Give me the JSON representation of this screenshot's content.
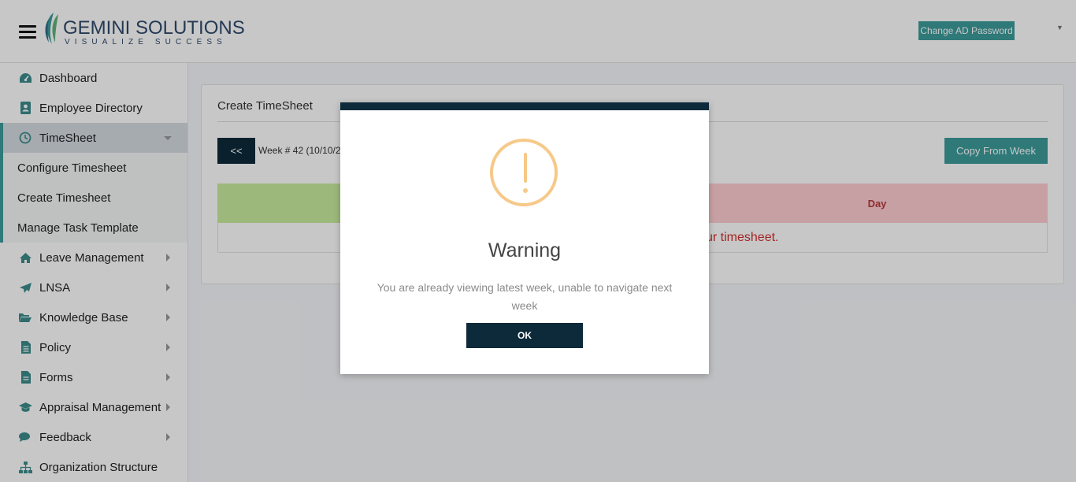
{
  "header": {
    "logo_title": "GEMINI SOLUTIONS",
    "logo_tagline": "VISUALIZE SUCCESS",
    "change_password_label": "Change AD Password"
  },
  "sidebar": {
    "items": [
      {
        "label": "Dashboard",
        "icon": "dashboard-icon"
      },
      {
        "label": "Employee Directory",
        "icon": "contact-book-icon"
      },
      {
        "label": "TimeSheet",
        "icon": "clock-icon"
      },
      {
        "label": "Leave Management",
        "icon": "home-icon"
      },
      {
        "label": "LNSA",
        "icon": "paper-plane-icon"
      },
      {
        "label": "Knowledge Base",
        "icon": "folder-open-icon"
      },
      {
        "label": "Policy",
        "icon": "document-icon"
      },
      {
        "label": "Forms",
        "icon": "file-icon"
      },
      {
        "label": "Appraisal Management",
        "icon": "graduation-cap-icon"
      },
      {
        "label": "Feedback",
        "icon": "chat-icon"
      },
      {
        "label": "Organization Structure",
        "icon": "sitemap-icon"
      }
    ],
    "timesheet_sub": [
      {
        "label": "Configure Timesheet"
      },
      {
        "label": "Create Timesheet"
      },
      {
        "label": "Manage Task Template"
      }
    ]
  },
  "main": {
    "card_title": "Create TimeSheet",
    "prev_label": "<<",
    "week_label": "Week # 42 (10/10/2",
    "copy_label": "Copy From Week",
    "day_header": "Day",
    "message_fragment": "ur timesheet."
  },
  "modal": {
    "title": "Warning",
    "message": "You are already viewing latest week, unable to navigate next week",
    "ok_label": "OK",
    "icon": "exclamation-icon"
  },
  "colors": {
    "accent": "#3d9c9c",
    "dark": "#0d2a3a",
    "warning": "#f6c989",
    "day_header_bg": "#ffcdd2",
    "green_header_bg": "#c8ee9e",
    "error_text": "#d32f2f"
  }
}
